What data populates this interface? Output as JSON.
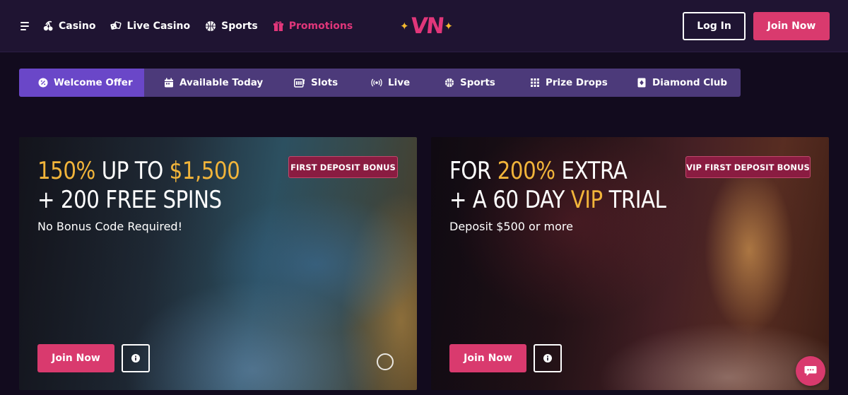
{
  "header": {
    "menu_icon": "hamburger-menu-icon",
    "nav": [
      {
        "label": "Casino",
        "icon": "cherries-icon"
      },
      {
        "label": "Live Casino",
        "icon": "dice-icon"
      },
      {
        "label": "Sports",
        "icon": "basketball-icon"
      },
      {
        "label": "Promotions",
        "icon": "gift-icon",
        "active": true
      }
    ],
    "logo_text": "VN",
    "login_label": "Log In",
    "join_label": "Join Now"
  },
  "tabs": [
    {
      "label": "Welcome Offer",
      "icon": "percent-badge-icon",
      "active": true
    },
    {
      "label": "Available Today",
      "icon": "calendar-icon"
    },
    {
      "label": "Slots",
      "icon": "slot-machine-icon"
    },
    {
      "label": "Live",
      "icon": "broadcast-icon"
    },
    {
      "label": "Sports",
      "icon": "basketball-icon"
    },
    {
      "label": "Prize Drops",
      "icon": "grid-dots-icon"
    },
    {
      "label": "Diamond Club",
      "icon": "diamond-card-icon"
    }
  ],
  "offers": [
    {
      "badge": "FIRST DEPOSIT BONUS",
      "headline_line1_gold1": "150%",
      "headline_line1_white": " UP TO ",
      "headline_line1_gold2": "$1,500",
      "headline_line2": "+ 200 FREE SPINS",
      "subline": "No Bonus Code Required!",
      "join_label": "Join Now"
    },
    {
      "badge": "VIP FIRST DEPOSIT BONUS",
      "headline_line1_white": "FOR ",
      "headline_line1_gold": "200%",
      "headline_line1_white2": " EXTRA",
      "headline_line2_white": "+ A 60 DAY ",
      "headline_line2_gold": "VIP",
      "headline_line2_white2": " TRIAL",
      "subline": "Deposit $500 or more",
      "join_label": "Join Now"
    }
  ],
  "colors": {
    "accent_pink": "#d93a6e",
    "gold": "#f1b43a",
    "tab_bar": "#4c3a7a",
    "tab_active": "#6a47c8",
    "header_bg": "#1f1432"
  }
}
